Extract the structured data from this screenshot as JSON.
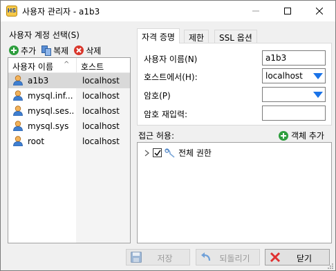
{
  "window": {
    "app_icon_text": "HS",
    "title": "사용자 관리자 - a1b3"
  },
  "left": {
    "caption": "사용자 계정 선택(S)",
    "toolbar": {
      "add_label": "추가",
      "clone_label": "복제",
      "delete_label": "삭제"
    },
    "columns": [
      "사용자 이름",
      "호스트"
    ],
    "sort_indicator": "^",
    "users": [
      {
        "name": "a1b3",
        "host": "localhost",
        "selected": true
      },
      {
        "name": "mysql.inf...",
        "host": "localhost",
        "selected": false
      },
      {
        "name": "mysql.ses...",
        "host": "localhost",
        "selected": false
      },
      {
        "name": "mysql.sys",
        "host": "localhost",
        "selected": false
      },
      {
        "name": "root",
        "host": "localhost",
        "selected": false
      }
    ]
  },
  "tabs": [
    {
      "label": "자격 증명",
      "active": true
    },
    {
      "label": "제한",
      "active": false
    },
    {
      "label": "SSL 옵션",
      "active": false
    }
  ],
  "credentials": {
    "username_label": "사용자 이름(N)",
    "username_value": "a1b3",
    "host_label": "호스트에서(H):",
    "host_value": "localhost",
    "password_label": "암호(P)",
    "password_value": "",
    "password_repeat_label": "암호 재입력:",
    "password_repeat_value": ""
  },
  "access": {
    "label": "접근 허용:",
    "add_object_label": "객체 추가",
    "tree_items": [
      {
        "label": "전체 권한",
        "checked": true,
        "expanded": false
      }
    ]
  },
  "buttons": {
    "save_label": "저장",
    "revert_label": "되돌리기",
    "close_label": "닫기"
  },
  "colors": {
    "add_green": "#2e9e3e",
    "delete_red": "#d9362b",
    "combo_arrow": "#1a73e8",
    "selection": "#d9d9d9",
    "close_x": "#e03030"
  }
}
